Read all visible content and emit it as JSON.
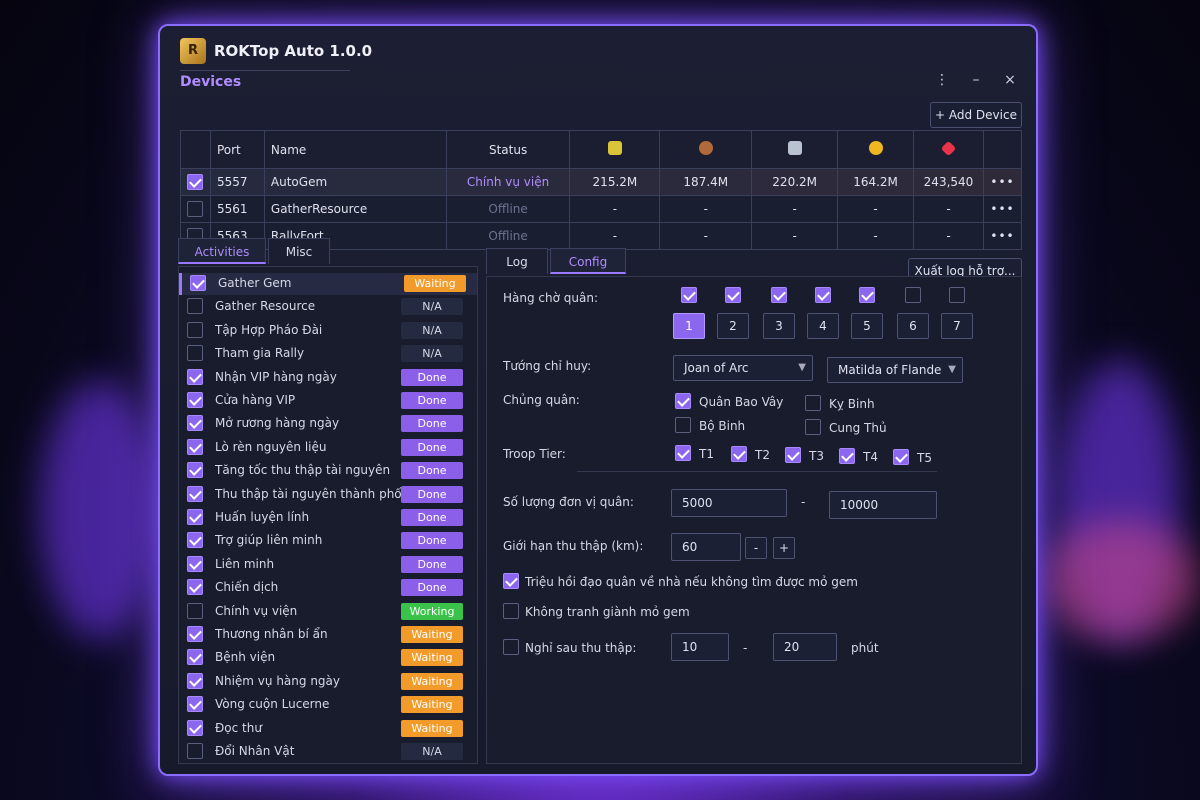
{
  "app": {
    "title": "ROKTop Auto 1.0.0",
    "logo_text": "R"
  },
  "devices_section": {
    "title": "Devices",
    "add_button": "+ Add Device"
  },
  "window_controls": {
    "menu": "⋮",
    "minimize": "–",
    "close": "×"
  },
  "devices_table": {
    "headers": {
      "port": "Port",
      "name": "Name",
      "status": "Status"
    },
    "resource_icons": [
      "food-icon",
      "wood-icon",
      "stone-icon",
      "gold-icon",
      "gem-icon"
    ],
    "rows": [
      {
        "checked": true,
        "port": "5557",
        "name": "AutoGem",
        "status": "Chính vụ viện",
        "food": "215.2M",
        "wood": "187.4M",
        "stone": "220.2M",
        "gold": "164.2M",
        "gem": "243,540",
        "more": "•••"
      },
      {
        "checked": false,
        "port": "5561",
        "name": "GatherResource",
        "status": "Offline",
        "food": "-",
        "wood": "-",
        "stone": "-",
        "gold": "-",
        "gem": "-",
        "more": "•••"
      },
      {
        "checked": false,
        "port": "5563",
        "name": "RallyFort",
        "status": "Offline",
        "food": "-",
        "wood": "-",
        "stone": "-",
        "gold": "-",
        "gem": "-",
        "more": "•••"
      }
    ]
  },
  "left_tabs": {
    "activities": "Activities",
    "misc": "Misc"
  },
  "activities": [
    {
      "checked": true,
      "label": "Gather Gem",
      "status": "Waiting",
      "type": "wait"
    },
    {
      "checked": false,
      "label": "Gather Resource",
      "status": "N/A",
      "type": "na"
    },
    {
      "checked": false,
      "label": "Tập Hợp Pháo Đài",
      "status": "N/A",
      "type": "na"
    },
    {
      "checked": false,
      "label": "Tham gia Rally",
      "status": "N/A",
      "type": "na"
    },
    {
      "checked": true,
      "label": "Nhận VIP hàng ngày",
      "status": "Done",
      "type": "done"
    },
    {
      "checked": true,
      "label": "Cửa hàng VIP",
      "status": "Done",
      "type": "done"
    },
    {
      "checked": true,
      "label": "Mở rương hàng ngày",
      "status": "Done",
      "type": "done"
    },
    {
      "checked": true,
      "label": "Lò rèn nguyên liệu",
      "status": "Done",
      "type": "done"
    },
    {
      "checked": true,
      "label": "Tăng tốc thu thập tài nguyên",
      "status": "Done",
      "type": "done"
    },
    {
      "checked": true,
      "label": "Thu thập tài nguyên thành phố",
      "status": "Done",
      "type": "done"
    },
    {
      "checked": true,
      "label": "Huấn luyện lính",
      "status": "Done",
      "type": "done"
    },
    {
      "checked": true,
      "label": "Trợ giúp liên minh",
      "status": "Done",
      "type": "done"
    },
    {
      "checked": true,
      "label": "Liên minh",
      "status": "Done",
      "type": "done"
    },
    {
      "checked": true,
      "label": "Chiến dịch",
      "status": "Done",
      "type": "done"
    },
    {
      "checked": false,
      "label": "Chính vụ viện",
      "status": "Working",
      "type": "work"
    },
    {
      "checked": true,
      "label": "Thương nhân bí ẩn",
      "status": "Waiting",
      "type": "wait"
    },
    {
      "checked": true,
      "label": "Bệnh viện",
      "status": "Waiting",
      "type": "wait"
    },
    {
      "checked": true,
      "label": "Nhiệm vụ hàng ngày",
      "status": "Waiting",
      "type": "wait"
    },
    {
      "checked": true,
      "label": "Vòng cuộn Lucerne",
      "status": "Waiting",
      "type": "wait"
    },
    {
      "checked": true,
      "label": "Đọc thư",
      "status": "Waiting",
      "type": "wait"
    },
    {
      "checked": false,
      "label": "Đổi Nhân Vật",
      "status": "N/A",
      "type": "na"
    }
  ],
  "config_tabs": {
    "log": "Log",
    "config": "Config"
  },
  "export_button": "Xuất log hỗ trợ...",
  "config": {
    "queue_label": "Hàng chờ quân:",
    "queues": [
      {
        "checked": true,
        "num": "1",
        "selected": true
      },
      {
        "checked": true,
        "num": "2",
        "selected": false
      },
      {
        "checked": true,
        "num": "3",
        "selected": false
      },
      {
        "checked": true,
        "num": "4",
        "selected": false
      },
      {
        "checked": true,
        "num": "5",
        "selected": false
      },
      {
        "checked": false,
        "num": "6",
        "selected": false
      },
      {
        "checked": false,
        "num": "7",
        "selected": false
      }
    ],
    "commander_label": "Tướng chỉ huy:",
    "commander_primary": "Joan of Arc",
    "commander_secondary": "Matilda of Flande",
    "troop_type_label": "Chủng quân:",
    "troop_types": [
      {
        "label": "Quân Bao Vây",
        "checked": true
      },
      {
        "label": "Kỵ Binh",
        "checked": false
      },
      {
        "label": "Bộ Binh",
        "checked": false
      },
      {
        "label": "Cung Thủ",
        "checked": false
      }
    ],
    "tier_label": "Troop Tier:",
    "tiers": [
      {
        "label": "T1",
        "checked": true
      },
      {
        "label": "T2",
        "checked": true
      },
      {
        "label": "T3",
        "checked": true
      },
      {
        "label": "T4",
        "checked": true
      },
      {
        "label": "T5",
        "checked": true
      }
    ],
    "unit_count_label": "Số lượng đơn vị quân:",
    "unit_min": "5000",
    "unit_max": "10000",
    "range_dash": "-",
    "gather_limit_label": "Giới hạn thu thập (km):",
    "gather_limit": "60",
    "minus": "-",
    "plus": "+",
    "recall_label": "Triệu hồi đạo quân về nhà nếu không tìm được mỏ gem",
    "recall_checked": true,
    "no_compete_label": "Không tranh giành mỏ gem",
    "no_compete_checked": false,
    "rest_label": "Nghỉ sau thu thập:",
    "rest_checked": false,
    "rest_min": "10",
    "rest_max": "20",
    "rest_unit": "phút"
  }
}
